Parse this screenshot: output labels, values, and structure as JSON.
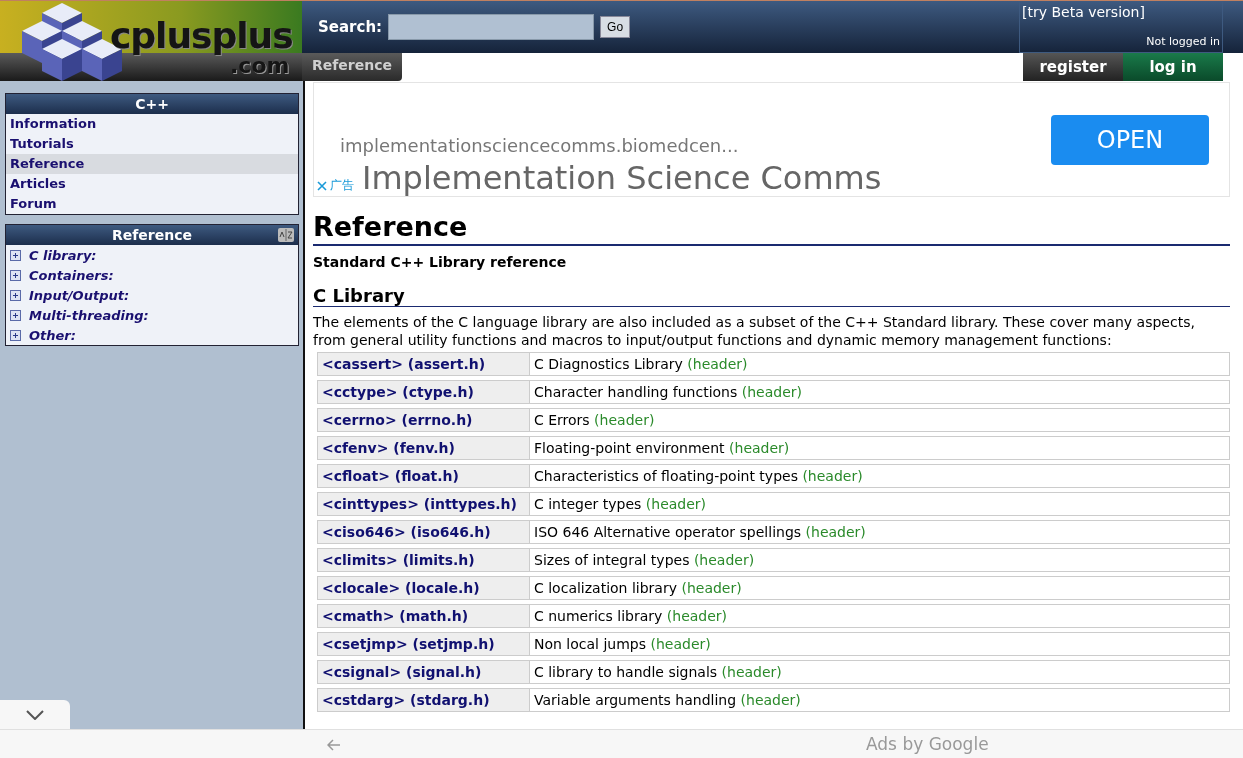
{
  "header": {
    "logo_text": "cplusplus",
    "logo_suffix": ".com",
    "search_label": "Search:",
    "search_button": "Go",
    "beta_link": "[try Beta version]",
    "login_status": "Not logged in",
    "breadcrumb": "Reference",
    "buttons": [
      {
        "label": "register",
        "kind": "register"
      },
      {
        "label": "log in",
        "kind": "login"
      }
    ]
  },
  "sidebar": {
    "menu": {
      "title": "C++",
      "items": [
        {
          "label": "Information",
          "selected": false
        },
        {
          "label": "Tutorials",
          "selected": false
        },
        {
          "label": "Reference",
          "selected": true
        },
        {
          "label": "Articles",
          "selected": false
        },
        {
          "label": "Forum",
          "selected": false
        }
      ]
    },
    "tree": {
      "title": "Reference",
      "items": [
        {
          "label": "C library:",
          "expanded": false
        },
        {
          "label": "Containers:",
          "expanded": false
        },
        {
          "label": "Input/Output:",
          "expanded": false
        },
        {
          "label": "Multi-threading:",
          "expanded": false
        },
        {
          "label": "Other:",
          "expanded": false
        }
      ]
    }
  },
  "ad": {
    "url": "implementationsciencecomms.biomedcen...",
    "headline": "Implementation Science Comms",
    "button": "OPEN",
    "badge": "广告",
    "footer": "Ads by Google"
  },
  "content": {
    "title": "Reference",
    "subtitle": "Standard C++ Library reference",
    "section": "C Library",
    "paragraph": "The elements of the C language library are also included as a subset of the C++ Standard library. These cover many aspects, from general utility functions and macros to input/output functions and dynamic memory management functions:",
    "rows": [
      {
        "header": "<cassert> (assert.h)",
        "description": "C Diagnostics Library",
        "tag": "(header)"
      },
      {
        "header": "<cctype> (ctype.h)",
        "description": "Character handling functions",
        "tag": "(header)"
      },
      {
        "header": "<cerrno> (errno.h)",
        "description": "C Errors",
        "tag": "(header)"
      },
      {
        "header": "<cfenv> (fenv.h)",
        "description": "Floating-point environment",
        "tag": "(header)"
      },
      {
        "header": "<cfloat> (float.h)",
        "description": "Characteristics of floating-point types",
        "tag": "(header)"
      },
      {
        "header": "<cinttypes> (inttypes.h)",
        "description": "C integer types",
        "tag": "(header)"
      },
      {
        "header": "<ciso646> (iso646.h)",
        "description": "ISO 646 Alternative operator spellings",
        "tag": "(header)"
      },
      {
        "header": "<climits> (limits.h)",
        "description": "Sizes of integral types",
        "tag": "(header)"
      },
      {
        "header": "<clocale> (locale.h)",
        "description": "C localization library",
        "tag": "(header)"
      },
      {
        "header": "<cmath> (math.h)",
        "description": "C numerics library",
        "tag": "(header)"
      },
      {
        "header": "<csetjmp> (setjmp.h)",
        "description": "Non local jumps",
        "tag": "(header)"
      },
      {
        "header": "<csignal> (signal.h)",
        "description": "C library to handle signals",
        "tag": "(header)"
      },
      {
        "header": "<cstdarg> (stdarg.h)",
        "description": "Variable arguments handling",
        "tag": "(header)"
      }
    ]
  }
}
